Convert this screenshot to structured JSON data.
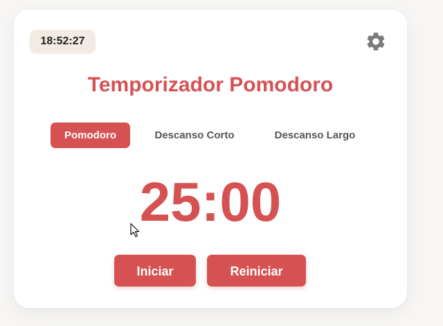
{
  "clock": {
    "time": "18:52:27"
  },
  "settings": {
    "icon": "gear-icon"
  },
  "title": "Temporizador Pomodoro",
  "tabs": [
    {
      "label": "Pomodoro",
      "active": true
    },
    {
      "label": "Descanso Corto",
      "active": false
    },
    {
      "label": "Descanso Largo",
      "active": false
    }
  ],
  "timer": {
    "display": "25:00"
  },
  "buttons": {
    "start_label": "Iniciar",
    "reset_label": "Reiniciar"
  },
  "colors": {
    "accent": "#d65252",
    "clock_bg": "#f3ebe3",
    "card_bg": "#ffffff",
    "page_bg": "#f7f6f4"
  }
}
